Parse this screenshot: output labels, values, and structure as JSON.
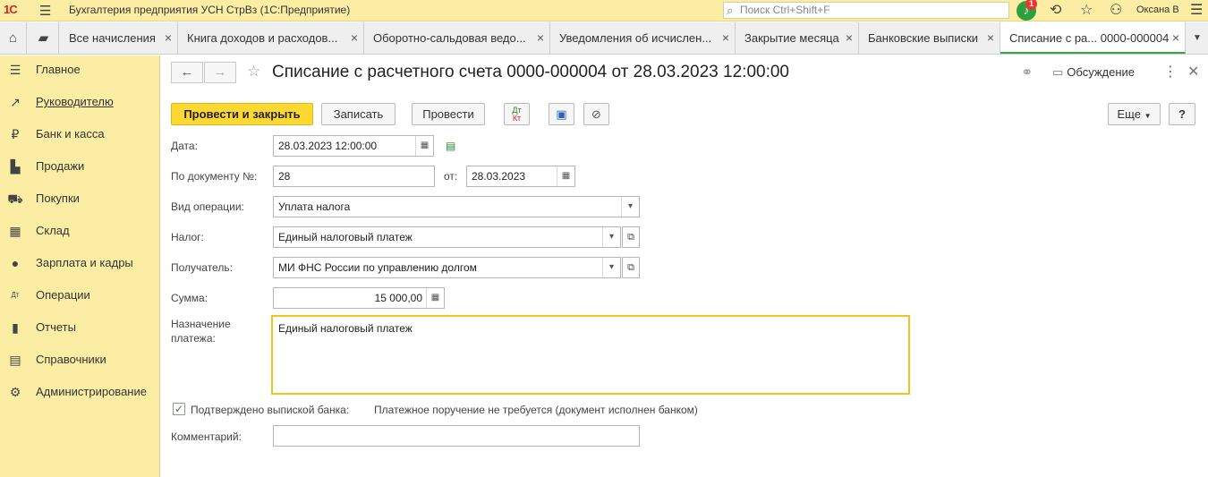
{
  "titlebar": {
    "logo": "1С",
    "app_title": "Бухгалтерия предприятия УСН СтрВз  (1С:Предприятие)",
    "search_placeholder": "Поиск Ctrl+Shift+F",
    "notification_count": "1",
    "user": "Оксана В"
  },
  "tabs": [
    {
      "label": "Все начисления"
    },
    {
      "label": "Книга доходов и расходов..."
    },
    {
      "label": "Оборотно-сальдовая ведо..."
    },
    {
      "label": "Уведомления об исчислен..."
    },
    {
      "label": "Закрытие месяца"
    },
    {
      "label": "Банковские выписки"
    },
    {
      "label": "Списание с ра...   0000-000004"
    }
  ],
  "sidebar": {
    "items": [
      {
        "label": "Главное",
        "icon": "menu-icon"
      },
      {
        "label": "Руководителю",
        "icon": "trend-icon"
      },
      {
        "label": "Банк и касса",
        "icon": "ruble-icon"
      },
      {
        "label": "Продажи",
        "icon": "bag-icon"
      },
      {
        "label": "Покупки",
        "icon": "cart-icon"
      },
      {
        "label": "Склад",
        "icon": "warehouse-icon"
      },
      {
        "label": "Зарплата и кадры",
        "icon": "person-icon"
      },
      {
        "label": "Операции",
        "icon": "dt-kt-icon"
      },
      {
        "label": "Отчеты",
        "icon": "bar-chart-icon"
      },
      {
        "label": "Справочники",
        "icon": "books-icon"
      },
      {
        "label": "Администрирование",
        "icon": "gear-icon"
      }
    ]
  },
  "document": {
    "title": "Списание с расчетного счета 0000-000004 от 28.03.2023 12:00:00",
    "discussion_label": "Обсуждение"
  },
  "toolbar": {
    "post_close": "Провести и закрыть",
    "save": "Записать",
    "post": "Провести",
    "dt": "Дт",
    "kt": "Кт",
    "more": "Еще",
    "help": "?"
  },
  "form": {
    "date_label": "Дата:",
    "date_value": "28.03.2023 12:00:00",
    "doc_no_label": "По документу №:",
    "doc_no_value": "28",
    "from_label": "от:",
    "from_value": "28.03.2023",
    "operation_label": "Вид операции:",
    "operation_value": "Уплата налога",
    "tax_label": "Налог:",
    "tax_value": "Единый налоговый платеж",
    "recipient_label": "Получатель:",
    "recipient_value": "МИ ФНС России по управлению долгом",
    "amount_label": "Сумма:",
    "amount_value": "15 000,00",
    "purpose_label_1": "Назначение",
    "purpose_label_2": "платежа:",
    "purpose_value": "Единый налоговый платеж",
    "confirmed_label": "Подтверждено выпиской банка:",
    "confirmed_checked": true,
    "confirmed_note": "Платежное поручение не требуется (документ исполнен банком)",
    "comment_label": "Комментарий:",
    "comment_value": ""
  },
  "colors": {
    "sidebar_bg": "#fbeda4",
    "primary_button": "#fcd830",
    "active_tab_accent": "#3aa44a",
    "focus_border": "#f0c419"
  }
}
